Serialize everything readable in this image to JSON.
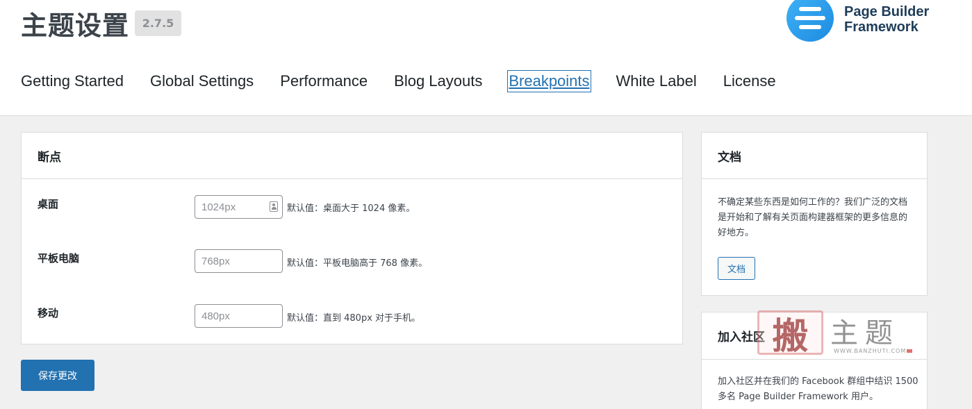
{
  "header": {
    "title": "主题设置",
    "version": "2.7.5",
    "brand": {
      "line1": "Page Builder",
      "line2": "Framework",
      "icon": "page-builder-framework-logo"
    }
  },
  "nav": {
    "tabs": [
      {
        "label": "Getting Started",
        "active": false
      },
      {
        "label": "Global Settings",
        "active": false
      },
      {
        "label": "Performance",
        "active": false
      },
      {
        "label": "Blog Layouts",
        "active": false
      },
      {
        "label": "Breakpoints",
        "active": true
      },
      {
        "label": "White Label",
        "active": false
      },
      {
        "label": "License",
        "active": false
      }
    ]
  },
  "breakpoints": {
    "heading": "断点",
    "rows": [
      {
        "label": "桌面",
        "placeholder": "1024px",
        "hint": "默认值：桌面大于 1024 像素。"
      },
      {
        "label": "平板电脑",
        "placeholder": "768px",
        "hint": "默认值：平板电脑高于 768 像素。"
      },
      {
        "label": "移动",
        "placeholder": "480px",
        "hint": "默认值：直到 480px 对于手机。"
      }
    ],
    "save_label": "保存更改"
  },
  "sidebar": {
    "docs": {
      "heading": "文档",
      "body": "不确定某些东西是如何工作的？我们广泛的文档是开始和了解有关页面构建器框架的更多信息的好地方。",
      "button": "文档"
    },
    "community": {
      "heading": "加入社区",
      "body": "加入社区并在我们的 Facebook 群组中结识 1500 多名 Page Builder Framework 用户。"
    }
  },
  "watermark": {
    "seal": "搬",
    "text": "主题",
    "url": "WWW.BANZHUTI.COM"
  },
  "colors": {
    "accent": "#2271b1",
    "background": "#f0f0f1",
    "brand": "#1e8be0"
  }
}
